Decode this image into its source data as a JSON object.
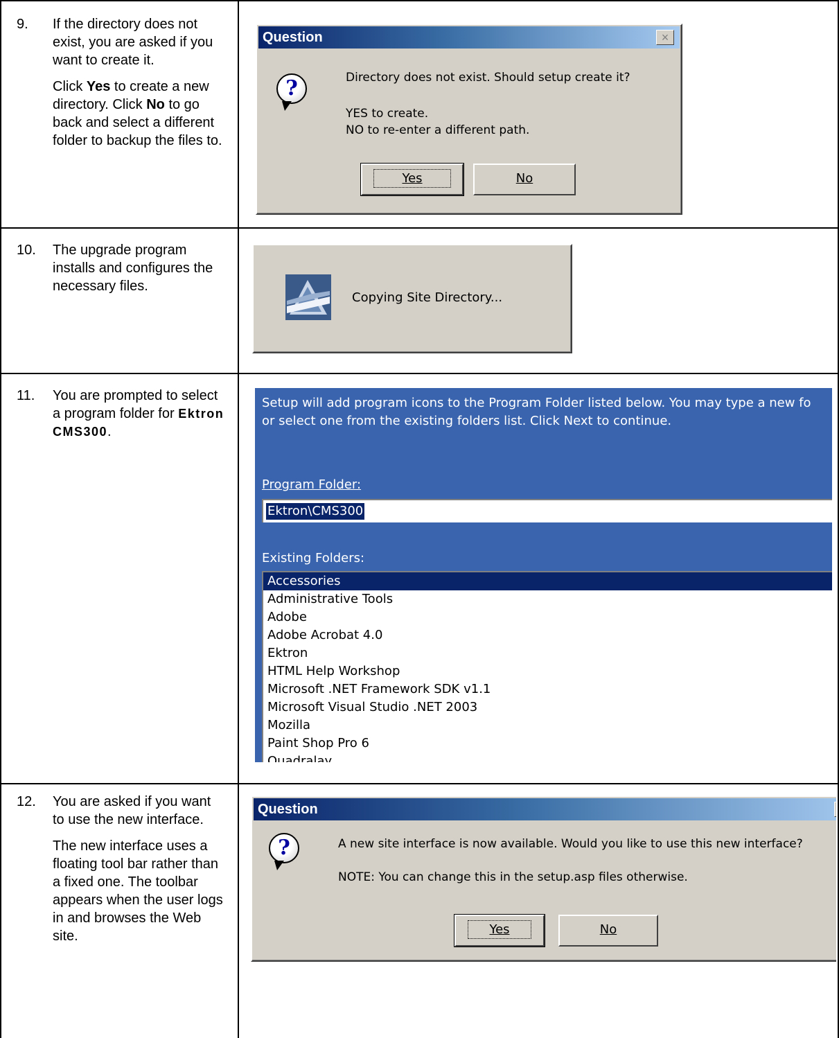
{
  "steps": [
    {
      "number": "9.",
      "para1": "If the directory does not exist, you are asked if you want to create it.",
      "para2_pre": "Click ",
      "para2_bold1": "Yes",
      "para2_mid": " to create a new directory. Click ",
      "para2_bold2": "No",
      "para2_post": " to go back and select a different folder to backup the files to."
    },
    {
      "number": "10.",
      "para1": "The upgrade program installs and configures the necessary files."
    },
    {
      "number": "11.",
      "para1_pre": "You are prompted to select a program folder for ",
      "para1_bold": "Ektron CMS300",
      "para1_post": "."
    },
    {
      "number": "12.",
      "para1": "You are asked if you want to use the new interface.",
      "para2": "The new interface uses a floating tool bar rather than a fixed one. The toolbar appears when the user logs in and browses the Web site."
    }
  ],
  "dialog1": {
    "title": "Question",
    "close_symbol": "×",
    "message": "Directory does not exist. Should setup create it?",
    "line2": "YES to create.",
    "line3": "NO to re-enter a different path.",
    "yes_label": "Yes",
    "no_label": "No"
  },
  "copying": {
    "message": "Copying Site Directory..."
  },
  "setup_panel": {
    "intro_line1": "Setup will add program icons to the Program Folder listed below.  You may type a new fo",
    "intro_line2": "or select one from the existing folders list.  Click Next to continue.",
    "program_folder_label": "Program Folder:",
    "program_folder_value": "Ektron\\CMS300",
    "existing_folders_label": "Existing Folders:",
    "folders": [
      "Accessories",
      "Administrative Tools",
      "Adobe",
      "Adobe Acrobat 4.0",
      "Ektron",
      "HTML Help Workshop",
      "Microsoft .NET Framework SDK v1.1",
      "Microsoft Visual Studio .NET 2003",
      "Mozilla",
      "Paint Shop Pro 6",
      "Quadralay"
    ]
  },
  "dialog2": {
    "title": "Question",
    "close_symbol": "×",
    "message": "A new site interface is now available. Would you like to use this new interface?",
    "note": "NOTE: You can change this in the setup.asp files otherwise.",
    "yes_label": "Yes",
    "no_label": "No"
  }
}
